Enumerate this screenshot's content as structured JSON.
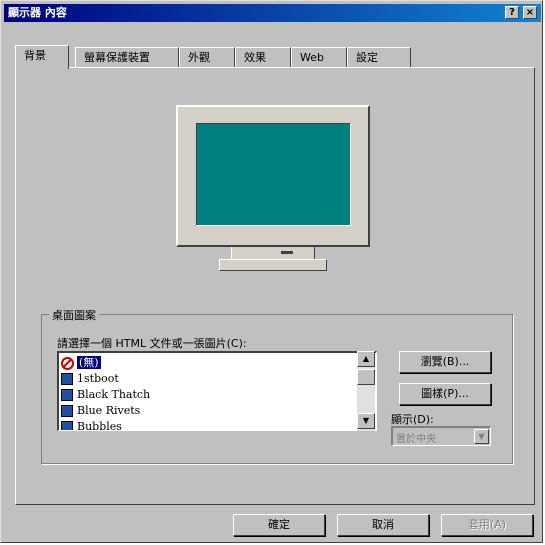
{
  "window": {
    "title": "顯示器 內容",
    "help_button": "?",
    "close_button": "×"
  },
  "tabs": [
    {
      "label": "背景"
    },
    {
      "label": "螢幕保護裝置"
    },
    {
      "label": "外觀"
    },
    {
      "label": "效果"
    },
    {
      "label": "Web"
    },
    {
      "label": "設定"
    }
  ],
  "active_tab": "背景",
  "wallpaper_group": {
    "label": "桌面圖案",
    "prompt": "請選擇一個 HTML 文件或一張圖片(C):",
    "items": [
      {
        "label": "(無)",
        "selected": true,
        "icon": "none-icon"
      },
      {
        "label": "1stboot",
        "icon": "image-file-icon"
      },
      {
        "label": "Black Thatch",
        "icon": "image-file-icon"
      },
      {
        "label": "Blue Rivets",
        "icon": "image-file-icon"
      },
      {
        "label": "Bubbles",
        "icon": "image-file-icon"
      }
    ],
    "browse_button": "瀏覽(B)...",
    "pattern_button": "圖樣(P)...",
    "display_label": "顯示(D):",
    "display_value": "置於中央"
  },
  "footer": {
    "ok": "確定",
    "cancel": "取消",
    "apply": "套用(A)"
  },
  "colors": {
    "title_start": "#000080",
    "title_end": "#1084d0",
    "screen": "#008080",
    "face": "#c0c0c0"
  }
}
